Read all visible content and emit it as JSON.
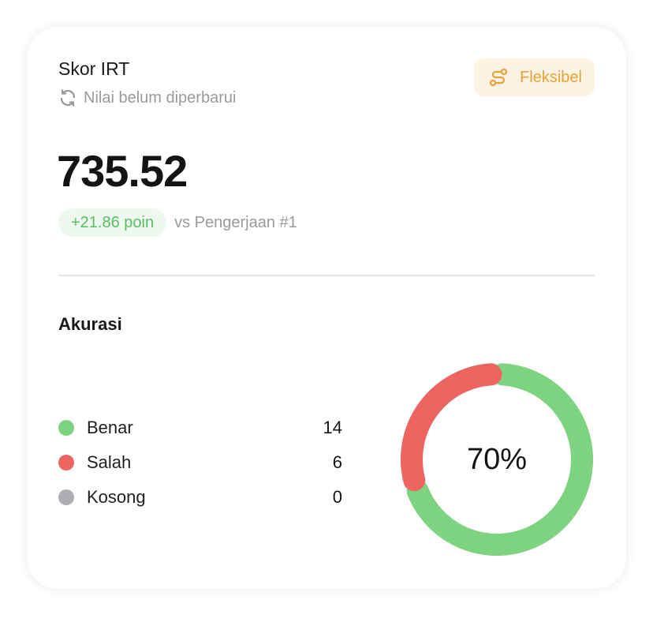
{
  "header": {
    "title": "Skor IRT",
    "status_text": "Nilai belum diperbarui",
    "status_icon": "refresh-icon",
    "mode_badge": {
      "label": "Fleksibel",
      "icon": "route-icon",
      "color": "#e8a23c",
      "background": "#fdf3e2"
    }
  },
  "score": {
    "value": "735.52",
    "delta": "+21.86 poin",
    "comparison": "vs Pengerjaan #1",
    "delta_color": "#59bf65"
  },
  "accuracy": {
    "title": "Akurasi",
    "percent_label": "70%",
    "items": [
      {
        "label": "Benar",
        "value": "14",
        "color": "#7ed381"
      },
      {
        "label": "Salah",
        "value": "6",
        "color": "#ec6561"
      },
      {
        "label": "Kosong",
        "value": "0",
        "color": "#adadb2"
      }
    ]
  },
  "chart_data": {
    "type": "pie",
    "categories": [
      "Benar",
      "Salah",
      "Kosong"
    ],
    "values": [
      14,
      6,
      0
    ],
    "colors": [
      "#7ed381",
      "#ec6561",
      "#adadb2"
    ],
    "center_label": "70%",
    "title": "Akurasi"
  }
}
